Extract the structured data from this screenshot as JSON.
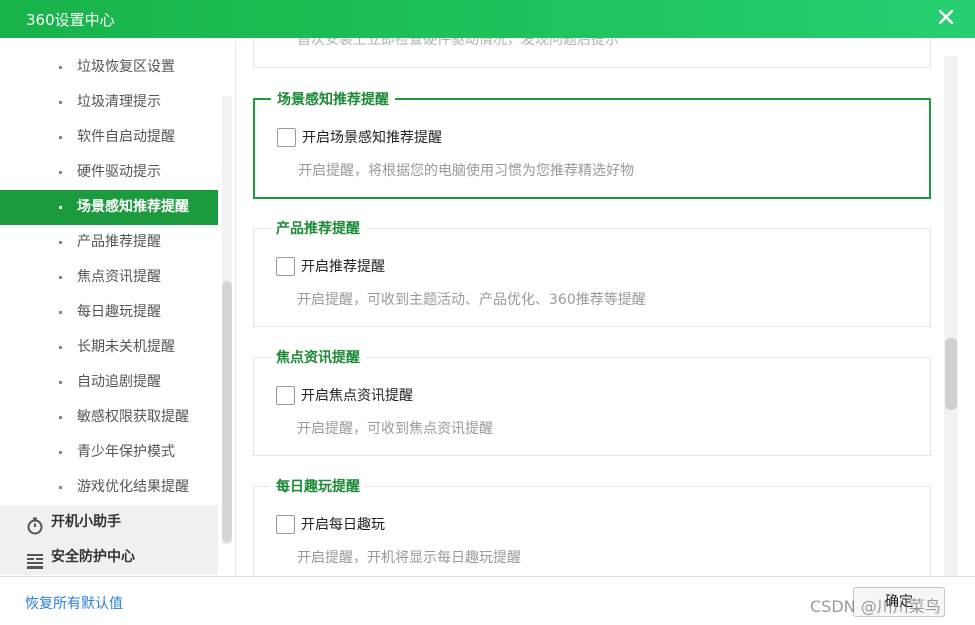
{
  "window": {
    "title": "360设置中心",
    "close_icon": "close-icon"
  },
  "sidebar": {
    "items": [
      {
        "label": "垃圾恢复区设置",
        "active": false
      },
      {
        "label": "垃圾清理提示",
        "active": false
      },
      {
        "label": "软件自启动提醒",
        "active": false
      },
      {
        "label": "硬件驱动提示",
        "active": false
      },
      {
        "label": "场景感知推荐提醒",
        "active": true
      },
      {
        "label": "产品推荐提醒",
        "active": false
      },
      {
        "label": "焦点资讯提醒",
        "active": false
      },
      {
        "label": "每日趣玩提醒",
        "active": false
      },
      {
        "label": "长期未关机提醒",
        "active": false
      },
      {
        "label": "自动追剧提醒",
        "active": false
      },
      {
        "label": "敏感权限获取提醒",
        "active": false
      },
      {
        "label": "青少年保护模式",
        "active": false
      },
      {
        "label": "游戏优化结果提醒",
        "active": false
      }
    ],
    "groups": [
      {
        "label": "开机小助手",
        "icon": "stopwatch-icon"
      },
      {
        "label": "安全防护中心",
        "icon": "shield-grid-icon"
      }
    ]
  },
  "content": {
    "partial_top_text": "首次安装上立即检查硬件驱动情况，发现问题后提示",
    "sections": [
      {
        "legend": "场景感知推荐提醒",
        "checkbox_label": "开启场景感知推荐提醒",
        "checked": false,
        "description": "开启提醒，将根据您的电脑使用习惯为您推荐精选好物",
        "highlighted": true
      },
      {
        "legend": "产品推荐提醒",
        "checkbox_label": "开启推荐提醒",
        "checked": false,
        "description": "开启提醒，可收到主题活动、产品优化、360推荐等提醒",
        "highlighted": false
      },
      {
        "legend": "焦点资讯提醒",
        "checkbox_label": "开启焦点资讯提醒",
        "checked": false,
        "description": "开启提醒，可收到焦点资讯提醒",
        "highlighted": false
      },
      {
        "legend": "每日趣玩提醒",
        "checkbox_label": "开启每日趣玩",
        "checked": false,
        "description": "开启提醒，开机将显示每日趣玩提醒",
        "highlighted": false
      }
    ]
  },
  "footer": {
    "reset_label": "恢复所有默认值",
    "ok_label": "确定"
  },
  "watermark": "CSDN @川川菜鸟",
  "colors": {
    "title_bar": "#1fc35b",
    "accent": "#1c9a3e",
    "legend": "#1c8a36",
    "link": "#2b7fd6"
  }
}
